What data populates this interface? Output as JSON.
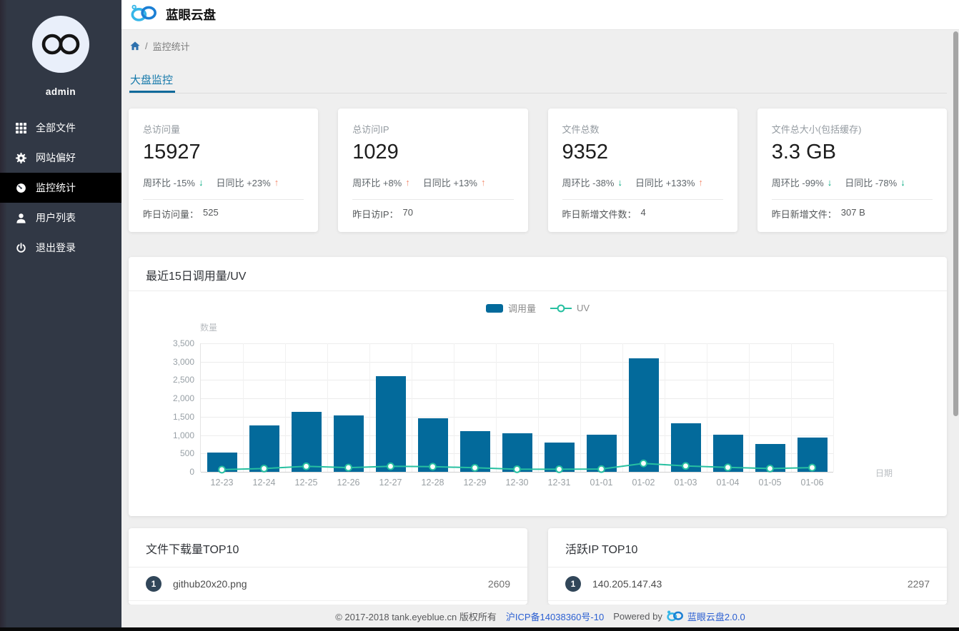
{
  "app": {
    "title": "蓝眼云盘"
  },
  "sidebar": {
    "username": "admin",
    "items": [
      {
        "label": "全部文件",
        "icon": "grid-icon",
        "active": false
      },
      {
        "label": "网站偏好",
        "icon": "gear-icon",
        "active": false
      },
      {
        "label": "监控统计",
        "icon": "dashboard-icon",
        "active": true
      },
      {
        "label": "用户列表",
        "icon": "user-icon",
        "active": false
      },
      {
        "label": "退出登录",
        "icon": "power-icon",
        "active": false
      }
    ]
  },
  "breadcrumb": {
    "separator": "/",
    "current": "监控统计"
  },
  "tabs": [
    {
      "label": "大盘监控",
      "active": true
    }
  ],
  "glyphs": {
    "up_arrow": "↑",
    "down_arrow": "↓"
  },
  "stat_cards": [
    {
      "label": "总访问量",
      "value": "15927",
      "week_label": "周环比",
      "week_change": "-15%",
      "week_dir": "down",
      "day_label": "日同比",
      "day_change": "+23%",
      "day_dir": "up",
      "footer_label": "昨日访问量：",
      "footer_value": "525"
    },
    {
      "label": "总访问IP",
      "value": "1029",
      "week_label": "周环比",
      "week_change": "+8%",
      "week_dir": "up",
      "day_label": "日同比",
      "day_change": "+13%",
      "day_dir": "up",
      "footer_label": "昨日访IP：",
      "footer_value": "70"
    },
    {
      "label": "文件总数",
      "value": "9352",
      "week_label": "周环比",
      "week_change": "-38%",
      "week_dir": "down",
      "day_label": "日同比",
      "day_change": "+133%",
      "day_dir": "up",
      "footer_label": "昨日新增文件数：",
      "footer_value": "4"
    },
    {
      "label": "文件总大小(包括缓存)",
      "value": "3.3 GB",
      "week_label": "周环比",
      "week_change": "-99%",
      "week_dir": "down",
      "day_label": "日同比",
      "day_change": "-78%",
      "day_dir": "down",
      "footer_label": "昨日新增文件：",
      "footer_value": "307 B"
    }
  ],
  "chart_data": {
    "type": "bar+line",
    "title": "最近15日调用量/UV",
    "categories": [
      "12-23",
      "12-24",
      "12-25",
      "12-26",
      "12-27",
      "12-28",
      "12-29",
      "12-30",
      "12-31",
      "01-01",
      "01-02",
      "01-03",
      "01-04",
      "01-05",
      "01-06"
    ],
    "series": [
      {
        "name": "调用量",
        "type": "bar",
        "color": "#036a9b",
        "values": [
          530,
          1260,
          1640,
          1530,
          2600,
          1450,
          1100,
          1050,
          800,
          1020,
          3100,
          1330,
          1020,
          760,
          940
        ]
      },
      {
        "name": "UV",
        "type": "line",
        "color": "#27c0a1",
        "values": [
          60,
          90,
          150,
          115,
          150,
          140,
          110,
          70,
          70,
          75,
          230,
          160,
          120,
          90,
          115
        ]
      }
    ],
    "xlabel": "日期",
    "ylabel": "数量",
    "ylim": [
      0,
      3500
    ],
    "ytick_step": 500,
    "yticks": [
      "0",
      "500",
      "1,000",
      "1,500",
      "2,000",
      "2,500",
      "3,000",
      "3,500"
    ],
    "legend_position": "top-center",
    "grid": true
  },
  "panels": [
    {
      "title": "文件下载量TOP10",
      "items": [
        {
          "rank": "1",
          "name": "github20x20.png",
          "value": "2609"
        }
      ]
    },
    {
      "title": "活跃IP TOP10",
      "items": [
        {
          "rank": "1",
          "name": "140.205.147.43",
          "value": "2297"
        }
      ]
    }
  ],
  "footer": {
    "copyright": "© 2017-2018 tank.eyeblue.cn 版权所有",
    "icp": "沪ICP备14038360号-10",
    "powered_prefix": "Powered by",
    "brand": "蓝眼云盘2.0.0"
  },
  "colors": {
    "bar": "#036a9b",
    "line": "#27c0a1",
    "up": "#f38a6d",
    "down": "#00a87e",
    "tab_accent": "#1478aa",
    "link": "#2b5fd2",
    "badge": "#314659",
    "sidebar_bg": "#313845",
    "logo_light": "#35b6e8",
    "logo_dark": "#1b7fd4"
  }
}
